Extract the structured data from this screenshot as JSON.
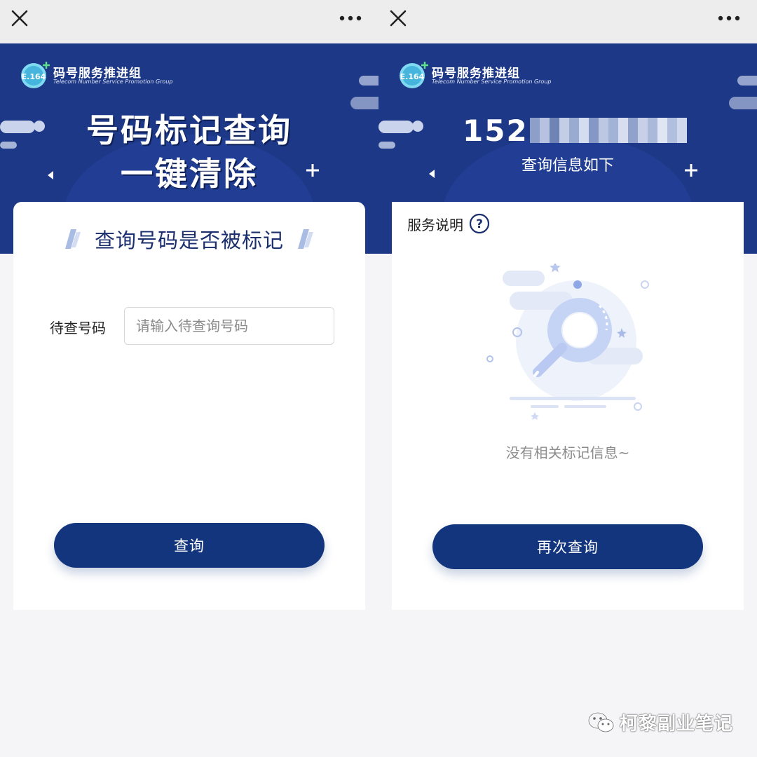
{
  "colors": {
    "brand_navy": "#1d3887",
    "button_navy": "#13357d",
    "title_navy": "#1b2f6e",
    "topbar_gray": "#ededed",
    "page_background": "#f5f5f7",
    "muted_text": "#8c8c8c"
  },
  "topbar": {
    "close_icon": "close-icon",
    "more_icon": "more-dots-icon"
  },
  "brand": {
    "badge_text": "E.164",
    "org_name": "码号服务推进组",
    "org_name_en": "Telecom Number Service Promotion Group"
  },
  "query_screen": {
    "banner_title_line1": "号码标记查询",
    "banner_title_line2": "一键清除",
    "card_title": "查询号码是否被标记",
    "phone_field_label": "待查号码",
    "phone_field_value": "",
    "phone_field_placeholder": "请输入待查询号码",
    "submit_label": "查询"
  },
  "result_screen": {
    "number_visible_prefix": "152",
    "number_masked": true,
    "caption": "查询信息如下",
    "service_label": "服务说明",
    "help_icon_text": "?",
    "empty_message": "没有相关标记信息~",
    "retry_label": "再次查询"
  },
  "watermark": {
    "text": "柯黎副业笔记",
    "icon": "wechat-icon"
  }
}
